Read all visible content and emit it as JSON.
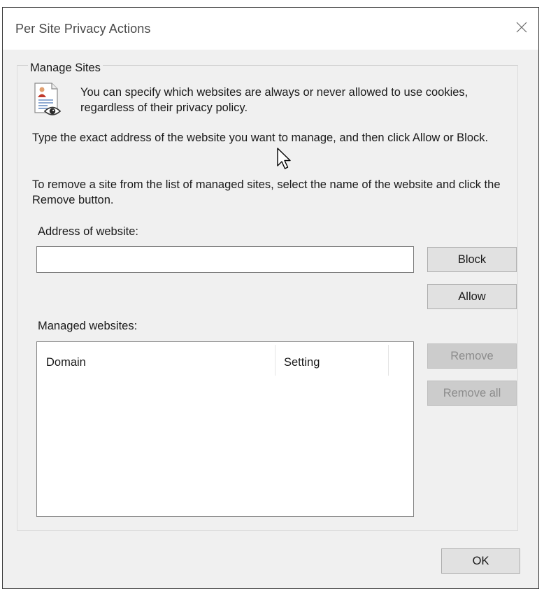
{
  "dialog": {
    "title": "Per Site Privacy Actions",
    "close_icon": "close-icon"
  },
  "group": {
    "legend": "Manage Sites",
    "icon": "privacy-document-eye-icon",
    "intro": "You can specify which websites are always or never allowed to use cookies, regardless of their privacy policy.",
    "instruction_add": "Type the exact address of the website you want to manage, and then click Allow or Block.",
    "instruction_remove": "To remove a site from the list of managed sites, select the name of the website and click the Remove button."
  },
  "address": {
    "label": "Address of website:",
    "value": "",
    "placeholder": ""
  },
  "buttons": {
    "block": "Block",
    "allow": "Allow",
    "remove": "Remove",
    "remove_all": "Remove all",
    "ok": "OK"
  },
  "managed": {
    "label": "Managed websites:",
    "columns": [
      "Domain",
      "Setting"
    ],
    "rows": []
  },
  "colors": {
    "dialog_bg": "#f0f0f0",
    "button_bg": "#e1e1e1",
    "disabled_text": "#8c8c8c"
  }
}
